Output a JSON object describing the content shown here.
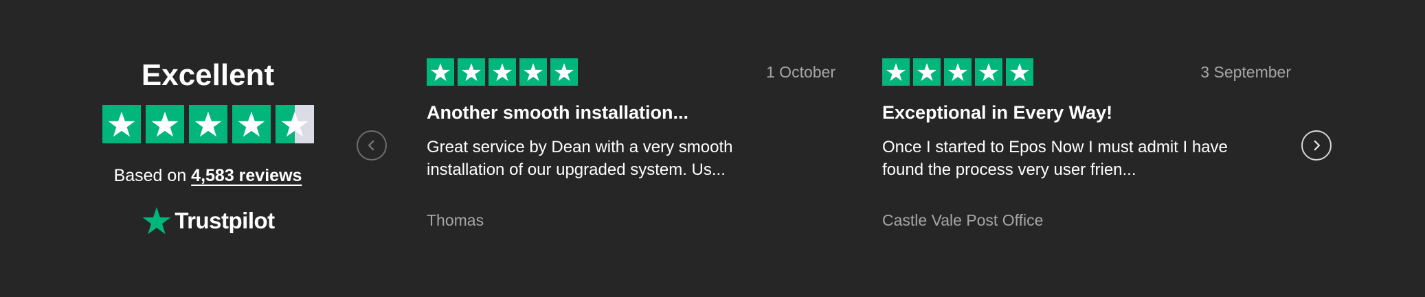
{
  "summary": {
    "title": "Excellent",
    "rating_stars": 4.5,
    "based_on_text": "Based on ",
    "reviews_link": "4,583 reviews",
    "brand_name": "Trustpilot"
  },
  "colors": {
    "background": "#262626",
    "star_green": "#00b67a",
    "star_empty": "#dcdce6",
    "muted_text": "#a6a6a6",
    "text": "#ffffff"
  },
  "navigation": {
    "prev_icon": "chevron-left-icon",
    "next_icon": "chevron-right-icon"
  },
  "reviews": [
    {
      "stars": 5,
      "date": "1 October",
      "title": "Another smooth installation...",
      "body": "Great service by Dean with a very smooth installation of our upgraded system. Us...",
      "author": "Thomas"
    },
    {
      "stars": 5,
      "date": "3 September",
      "title": "Exceptional in Every Way!",
      "body": "Once I started to Epos Now I must admit I have found the process very user frien...",
      "author": "Castle Vale Post Office"
    }
  ]
}
